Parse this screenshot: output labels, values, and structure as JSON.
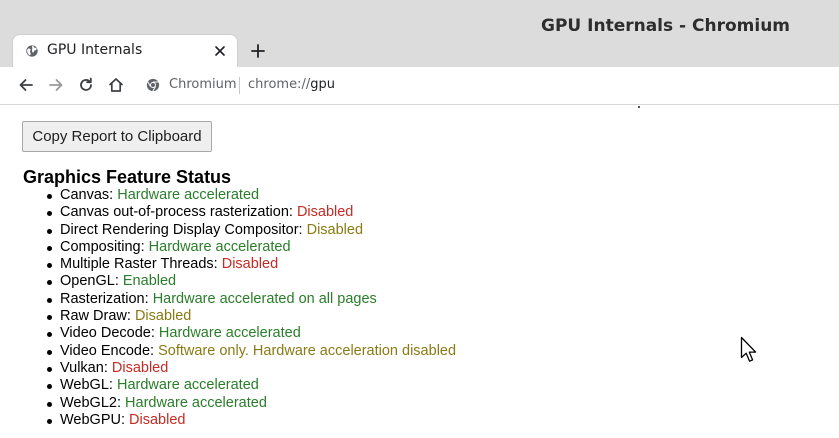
{
  "window": {
    "title": "GPU Internals - Chromium"
  },
  "tab": {
    "title": "GPU Internals",
    "favicon_icon": "globe-icon",
    "close_icon": "close-icon"
  },
  "new_tab_icon": "plus-icon",
  "toolbar": {
    "back_icon": "arrow-left-icon",
    "forward_icon": "arrow-right-icon",
    "reload_icon": "reload-icon",
    "home_icon": "home-icon",
    "site_icon": "chromium-icon",
    "site_label": "Chromium",
    "url_scheme": "chrome://",
    "url_host": "gpu"
  },
  "page": {
    "copy_button_label": "Copy Report to Clipboard",
    "section_heading": "Graphics Feature Status",
    "features": [
      {
        "name": "Canvas",
        "status": "Hardware accelerated",
        "color": "#2a7d2a"
      },
      {
        "name": "Canvas out-of-process rasterization",
        "status": "Disabled",
        "color": "#c62b23"
      },
      {
        "name": "Direct Rendering Display Compositor",
        "status": "Disabled",
        "color": "#8a7a14"
      },
      {
        "name": "Compositing",
        "status": "Hardware accelerated",
        "color": "#2a7d2a"
      },
      {
        "name": "Multiple Raster Threads",
        "status": "Disabled",
        "color": "#c62b23"
      },
      {
        "name": "OpenGL",
        "status": "Enabled",
        "color": "#2a7d2a"
      },
      {
        "name": "Rasterization",
        "status": "Hardware accelerated on all pages",
        "color": "#2a7d2a"
      },
      {
        "name": "Raw Draw",
        "status": "Disabled",
        "color": "#8a7a14"
      },
      {
        "name": "Video Decode",
        "status": "Hardware accelerated",
        "color": "#2a7d2a"
      },
      {
        "name": "Video Encode",
        "status": "Software only. Hardware acceleration disabled",
        "color": "#8a7a14"
      },
      {
        "name": "Vulkan",
        "status": "Disabled",
        "color": "#c62b23"
      },
      {
        "name": "WebGL",
        "status": "Hardware accelerated",
        "color": "#2a7d2a"
      },
      {
        "name": "WebGL2",
        "status": "Hardware accelerated",
        "color": "#2a7d2a"
      },
      {
        "name": "WebGPU",
        "status": "Disabled",
        "color": "#c62b23"
      }
    ]
  },
  "cursor_icon": "mouse-pointer-icon"
}
